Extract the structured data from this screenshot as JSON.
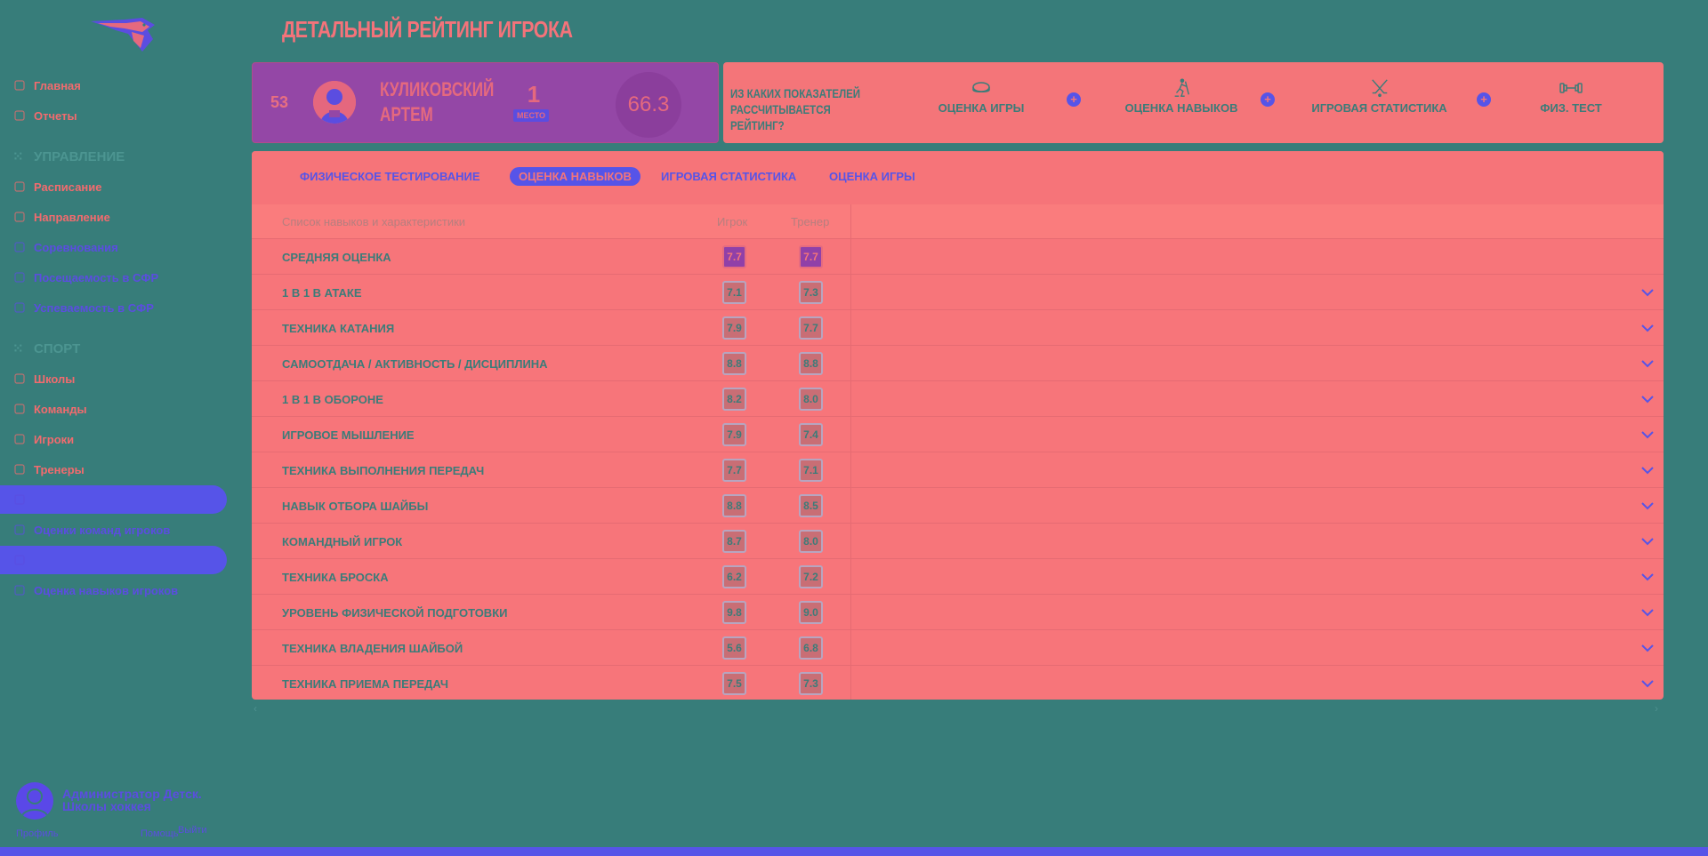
{
  "sidebar": {
    "items": [
      {
        "label": "Главная",
        "icon": "home-icon"
      },
      {
        "label": "Отчеты",
        "icon": "report-icon"
      }
    ],
    "section_management": "УПРАВЛЕНИЕ",
    "management_items": [
      {
        "label": "Расписание",
        "icon": "calendar-icon"
      },
      {
        "label": "Направление",
        "icon": "trophy-icon"
      },
      {
        "label": "Соревнования",
        "icon": "cup-icon"
      },
      {
        "label": "Посещаемость в СФР",
        "icon": "team-icon"
      },
      {
        "label": "Успеваемость в СФР",
        "icon": "team-icon"
      }
    ],
    "section_sport": "СПОРТ",
    "sport_items": [
      {
        "label": "Школы",
        "icon": "school-icon"
      },
      {
        "label": "Команды",
        "icon": "team-icon"
      },
      {
        "label": "Игроки",
        "icon": "player-icon"
      },
      {
        "label": "Тренеры",
        "icon": "coach-icon"
      },
      {
        "label": "Рейтинг",
        "icon": "rating-icon"
      },
      {
        "label": "Оценки команд игроков",
        "icon": "chart-icon"
      },
      {
        "label": "Матчи",
        "icon": "match-icon"
      },
      {
        "label": "Оценка навыков игроков",
        "icon": "chart-icon"
      }
    ],
    "user": {
      "name": "Администратор Детск. Школы хоккея",
      "profile": "Профиль",
      "settings": "Помощь",
      "logout": "Выйти"
    }
  },
  "page_title": "ДЕТАЛЬНЫЙ РЕЙТИНГ ИГРОКА",
  "player": {
    "number": "53",
    "name_line1": "КУЛИКОВСКИЙ",
    "name_line2": "АРТЕМ",
    "place": "1",
    "place_label": "МЕСТО",
    "score": "66.3"
  },
  "rating_info": {
    "question": "ИЗ КАКИХ ПОКАЗАТЕЛЕЙ РАССЧИТЫВАЕТСЯ РЕЙТИНГ?",
    "components": [
      {
        "label": "ОЦЕНКА ИГРЫ",
        "icon": "puck-icon"
      },
      {
        "label": "ОЦЕНКА НАВЫКОВ",
        "icon": "skater-icon"
      },
      {
        "label": "ИГРОВАЯ СТАТИСТИКА",
        "icon": "crossed-sticks-icon"
      },
      {
        "label": "ФИЗ. ТЕСТ",
        "icon": "dumbbell-icon"
      }
    ],
    "plus": "+"
  },
  "tabs": [
    {
      "label": "ФИЗИЧЕСКОЕ ТЕСТИРОВАНИЕ",
      "active": false
    },
    {
      "label": "ОЦЕНКА НАВЫКОВ",
      "active": true
    },
    {
      "label": "ИГРОВАЯ СТАТИСТИКА",
      "active": false
    },
    {
      "label": "ОЦЕНКА ИГРЫ",
      "active": false
    }
  ],
  "table": {
    "headers": {
      "skill": "Список навыков и характеристики",
      "player": "Игрок",
      "coach": "Тренер"
    },
    "rows": [
      {
        "skill": "СРЕДНЯЯ ОЦЕНКА",
        "player": "7.7",
        "coach": "7.7",
        "expandable": false
      },
      {
        "skill": "1 В 1 В АТАКЕ",
        "player": "7.1",
        "coach": "7.3",
        "expandable": true
      },
      {
        "skill": "ТЕХНИКА КАТАНИЯ",
        "player": "7.9",
        "coach": "7.7",
        "expandable": true
      },
      {
        "skill": "САМООТДАЧА / АКТИВНОСТЬ / ДИСЦИПЛИНА",
        "player": "8.8",
        "coach": "8.8",
        "expandable": true
      },
      {
        "skill": "1 В 1 В ОБОРОНЕ",
        "player": "8.2",
        "coach": "8.0",
        "expandable": true
      },
      {
        "skill": "ИГРОВОЕ МЫШЛЕНИЕ",
        "player": "7.9",
        "coach": "7.4",
        "expandable": true
      },
      {
        "skill": "ТЕХНИКА ВЫПОЛНЕНИЯ ПЕРЕДАЧ",
        "player": "7.7",
        "coach": "7.1",
        "expandable": true
      },
      {
        "skill": "НАВЫК ОТБОРА ШАЙБЫ",
        "player": "8.8",
        "coach": "8.5",
        "expandable": true
      },
      {
        "skill": "КОМАНДНЫЙ ИГРОК",
        "player": "8.7",
        "coach": "8.0",
        "expandable": true
      },
      {
        "skill": "ТЕХНИКА БРОСКА",
        "player": "6.2",
        "coach": "7.2",
        "expandable": true
      },
      {
        "skill": "УРОВЕНЬ ФИЗИЧЕСКОЙ ПОДГОТОВКИ",
        "player": "9.8",
        "coach": "9.0",
        "expandable": true
      },
      {
        "skill": "ТЕХНИКА ВЛАДЕНИЯ ШАЙБОЙ",
        "player": "5.6",
        "coach": "6.8",
        "expandable": true
      },
      {
        "skill": "ТЕХНИКА ПРИЕМА ПЕРЕДАЧ",
        "player": "7.5",
        "coach": "7.3",
        "expandable": true
      }
    ]
  },
  "colors": {
    "background": "#377d7a",
    "accent": "#5654e8",
    "panel": "#f7757a",
    "card": "#9447a6",
    "text_dark": "#3b7c79"
  }
}
